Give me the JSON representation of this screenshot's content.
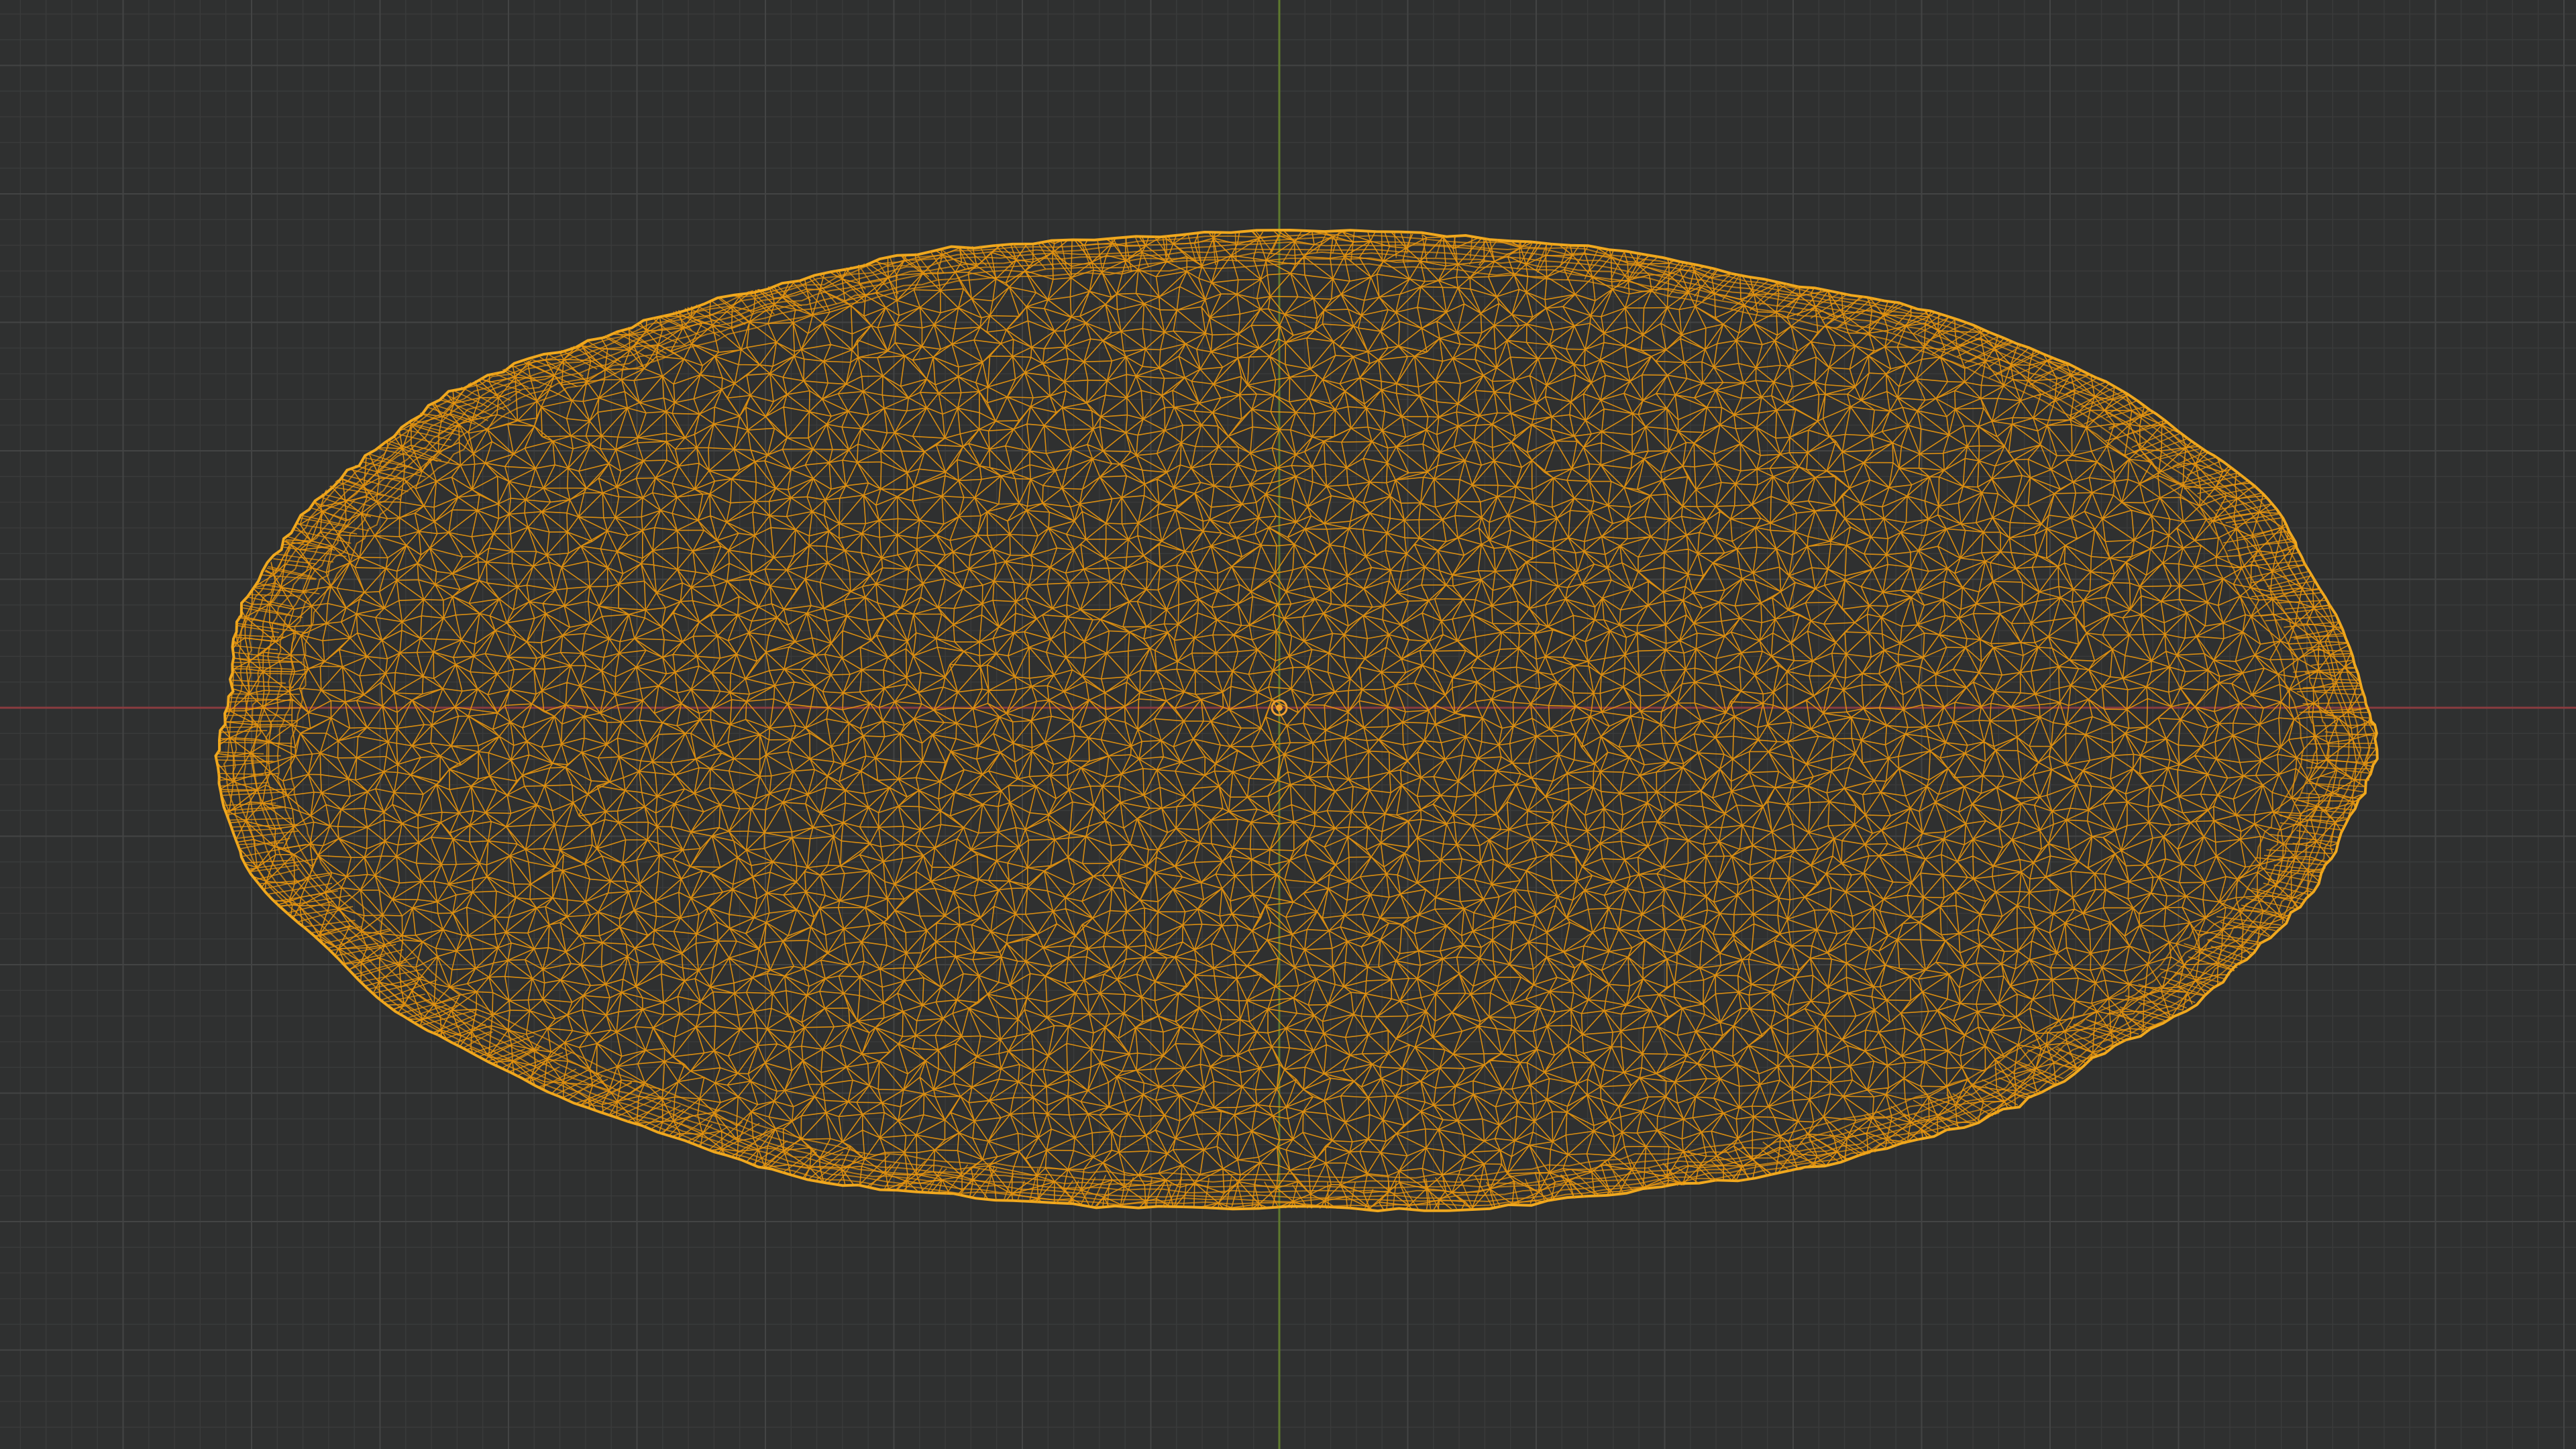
{
  "app": {
    "mode": "wireframe",
    "view": "3d-viewport"
  },
  "colors": {
    "background": "#2f3030",
    "grid_minor": "#3a3b3b",
    "grid_major": "#434444",
    "axis_x": "#8a3b3f",
    "axis_y": "#5f7a2e",
    "wire": "#e8960f",
    "wire_outline": "#f0a81e",
    "origin": "#f0a030"
  },
  "icons": {
    "origin_marker": "object-origin-icon",
    "mesh": "mesh-wireframe-icon"
  }
}
